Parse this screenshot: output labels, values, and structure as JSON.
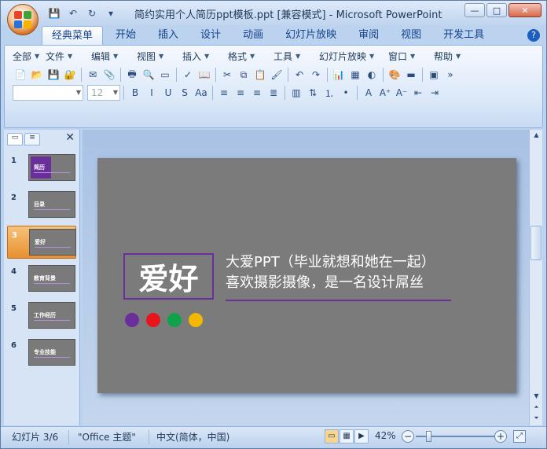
{
  "window": {
    "title": "简约实用个人简历ppt模板.ppt [兼容模式] - Microsoft PowerPoint",
    "controls": {
      "minimize": "—",
      "maximize": "□",
      "close": "✕"
    }
  },
  "qat": [
    {
      "name": "save-icon",
      "glyph": "💾"
    },
    {
      "name": "undo-icon",
      "glyph": "↶"
    },
    {
      "name": "redo-icon",
      "glyph": "↻"
    },
    {
      "name": "qat-dropdown-icon",
      "glyph": "▾"
    }
  ],
  "tabs": [
    "经典菜单",
    "开始",
    "插入",
    "设计",
    "动画",
    "幻灯片放映",
    "审阅",
    "视图",
    "开发工具"
  ],
  "active_tab": 0,
  "help": "?",
  "menus": [
    "全部",
    "文件",
    "编辑",
    "视图",
    "插入",
    "格式",
    "工具",
    "幻灯片放映",
    "窗口",
    "帮助"
  ],
  "toolbar": {
    "font_name": "",
    "font_size": "12",
    "row1": [
      {
        "name": "new-icon",
        "g": "📄"
      },
      {
        "name": "open-icon",
        "g": "📂"
      },
      {
        "name": "save-icon",
        "g": "💾"
      },
      {
        "name": "permission-icon",
        "g": "🔐"
      },
      {
        "name": "sep",
        "g": ""
      },
      {
        "name": "email-icon",
        "g": "✉"
      },
      {
        "name": "attach-icon",
        "g": "📎"
      },
      {
        "name": "sep",
        "g": ""
      },
      {
        "name": "print-icon",
        "g": "🖶"
      },
      {
        "name": "print-preview-icon",
        "g": "🔍"
      },
      {
        "name": "layout-icon",
        "g": "▭"
      },
      {
        "name": "sep",
        "g": ""
      },
      {
        "name": "spelling-icon",
        "g": "✓"
      },
      {
        "name": "research-icon",
        "g": "📖"
      },
      {
        "name": "sep",
        "g": ""
      },
      {
        "name": "cut-icon",
        "g": "✂"
      },
      {
        "name": "copy-icon",
        "g": "⧉"
      },
      {
        "name": "paste-icon",
        "g": "📋"
      },
      {
        "name": "format-painter-icon",
        "g": "🖌"
      },
      {
        "name": "sep",
        "g": ""
      },
      {
        "name": "undo-icon",
        "g": "↶"
      },
      {
        "name": "redo-icon",
        "g": "↷"
      },
      {
        "name": "sep",
        "g": ""
      },
      {
        "name": "chart-icon",
        "g": "📊"
      },
      {
        "name": "table-icon",
        "g": "▦"
      },
      {
        "name": "grayscale-icon",
        "g": "◐"
      },
      {
        "name": "sep",
        "g": ""
      },
      {
        "name": "color-scheme-icon",
        "g": "🎨"
      },
      {
        "name": "fill-icon",
        "g": "▬"
      },
      {
        "name": "sep",
        "g": ""
      },
      {
        "name": "new-slide-icon",
        "g": "▣"
      },
      {
        "name": "more-icon",
        "g": "»"
      }
    ],
    "row2": [
      {
        "name": "bold-icon",
        "g": "B"
      },
      {
        "name": "italic-icon",
        "g": "I"
      },
      {
        "name": "underline-icon",
        "g": "U"
      },
      {
        "name": "strike-icon",
        "g": "S"
      },
      {
        "name": "case-icon",
        "g": "Aa"
      },
      {
        "name": "sep",
        "g": ""
      },
      {
        "name": "align-left-icon",
        "g": "≡"
      },
      {
        "name": "align-center-icon",
        "g": "≡"
      },
      {
        "name": "align-right-icon",
        "g": "≡"
      },
      {
        "name": "justify-icon",
        "g": "≣"
      },
      {
        "name": "sep",
        "g": ""
      },
      {
        "name": "columns-icon",
        "g": "▥"
      },
      {
        "name": "text-direction-icon",
        "g": "⇅"
      },
      {
        "name": "numbering-icon",
        "g": "⒈"
      },
      {
        "name": "bullets-icon",
        "g": "•"
      },
      {
        "name": "sep",
        "g": ""
      },
      {
        "name": "font-color-icon",
        "g": "A"
      },
      {
        "name": "grow-font-icon",
        "g": "A⁺"
      },
      {
        "name": "shrink-font-icon",
        "g": "A⁻"
      },
      {
        "name": "decrease-indent-icon",
        "g": "⇤"
      },
      {
        "name": "increase-indent-icon",
        "g": "⇥"
      }
    ]
  },
  "slides_pane": {
    "close": "✕",
    "slides": [
      {
        "num": "1",
        "label": "简历"
      },
      {
        "num": "2",
        "label": "目录"
      },
      {
        "num": "3",
        "label": "爱好"
      },
      {
        "num": "4",
        "label": "教育背景"
      },
      {
        "num": "5",
        "label": "工作经历"
      },
      {
        "num": "6",
        "label": "专业技能"
      }
    ],
    "selected": 2
  },
  "slide": {
    "title": "爱好",
    "line1": "大爱PPT（毕业就想和她在一起）",
    "line2": "喜欢摄影摄像，是一名设计屌丝",
    "dot_colors": [
      "#6a2f9a",
      "#e8151b",
      "#0ea34a",
      "#f5b800"
    ],
    "background": "#7b7b7b",
    "accent": "#6a2f9a"
  },
  "status": {
    "slide_info": "幻灯片 3/6",
    "theme": "\"Office 主题\"",
    "language": "中文(简体，中国)",
    "zoom": "42%",
    "zoom_out": "−",
    "zoom_in": "+"
  }
}
